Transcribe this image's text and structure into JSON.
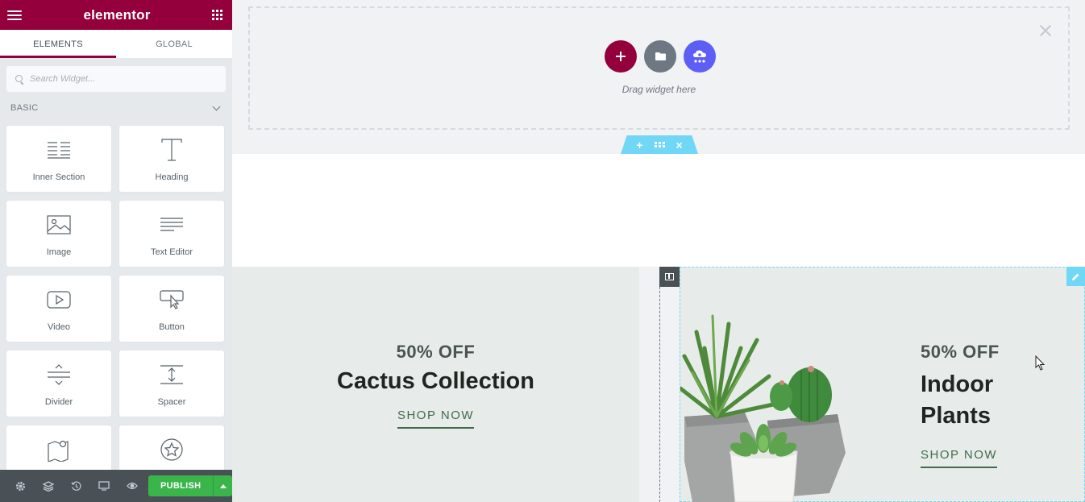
{
  "app": {
    "brand": "elementor"
  },
  "panel": {
    "tabs": [
      {
        "label": "ELEMENTS",
        "active": true
      },
      {
        "label": "GLOBAL",
        "active": false
      }
    ],
    "search": {
      "placeholder": "Search Widget...",
      "value": ""
    },
    "category": {
      "label": "BASIC"
    },
    "widgets": [
      {
        "label": "Inner Section",
        "icon": "inner-section-icon"
      },
      {
        "label": "Heading",
        "icon": "heading-icon"
      },
      {
        "label": "Image",
        "icon": "image-icon"
      },
      {
        "label": "Text Editor",
        "icon": "text-editor-icon"
      },
      {
        "label": "Video",
        "icon": "video-icon"
      },
      {
        "label": "Button",
        "icon": "button-icon"
      },
      {
        "label": "Divider",
        "icon": "divider-icon"
      },
      {
        "label": "Spacer",
        "icon": "spacer-icon"
      },
      {
        "label": "",
        "icon": "google-maps-icon"
      },
      {
        "label": "",
        "icon": "star-icon"
      }
    ]
  },
  "bottombar": {
    "publish_label": "PUBLISH",
    "icons": [
      "settings-icon",
      "navigator-icon",
      "history-icon",
      "responsive-icon",
      "preview-icon"
    ]
  },
  "canvas": {
    "drop_area": {
      "text": "Drag widget here"
    },
    "promos": [
      {
        "offer": "50% OFF",
        "title": "Cactus Collection",
        "cta": "SHOP NOW"
      },
      {
        "offer": "50% OFF",
        "title_line1": "Indoor",
        "title_line2": "Plants",
        "cta": "SHOP NOW"
      }
    ]
  },
  "colors": {
    "brand": "#93003c",
    "publish": "#39b54a",
    "editor_accent": "#71d7f7",
    "promo_bg": "#e7ecea",
    "cta": "#3f6b4b"
  }
}
